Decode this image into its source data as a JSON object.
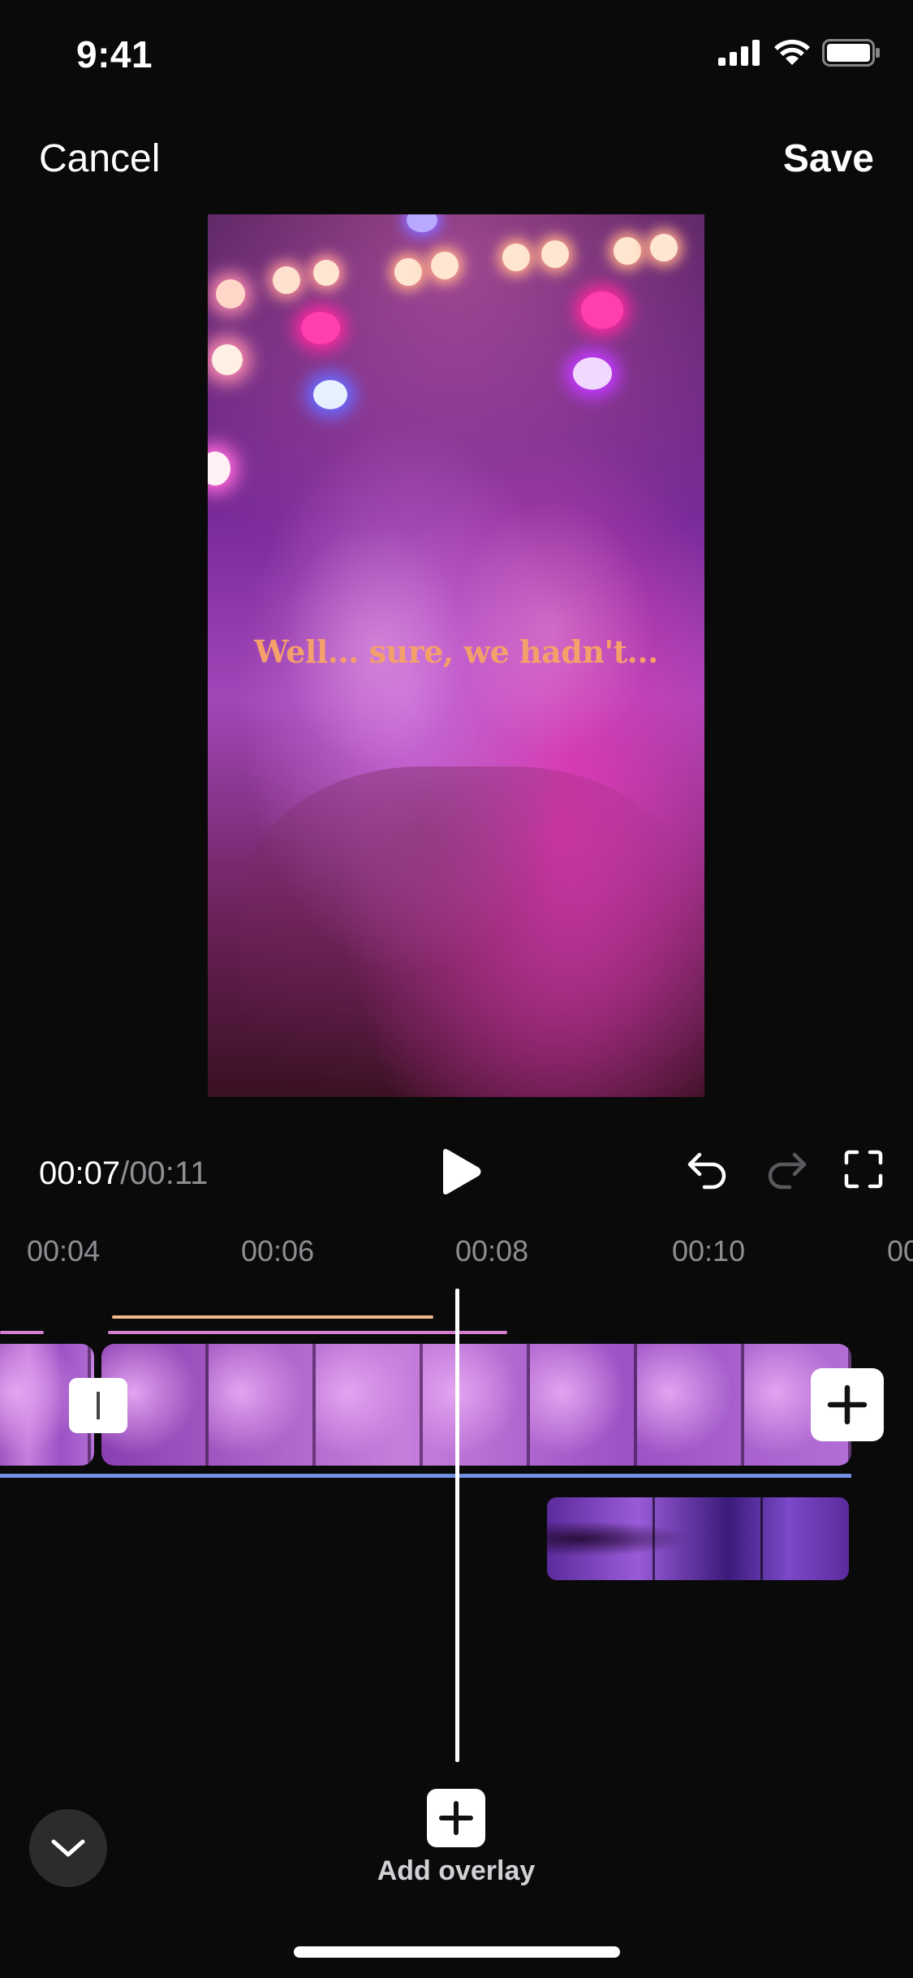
{
  "status_bar": {
    "time": "9:41",
    "icons": [
      "signal-icon",
      "wifi-icon",
      "battery-icon"
    ]
  },
  "nav": {
    "cancel_label": "Cancel",
    "save_label": "Save"
  },
  "preview": {
    "subtitle_text": "Well... sure, we hadn't...",
    "subtitle_color": "#f4a06a"
  },
  "playback": {
    "current_time": "00:07",
    "separator": "/",
    "total_time": "00:11",
    "icons": [
      "play-icon",
      "undo-icon",
      "redo-icon",
      "fullscreen-icon"
    ]
  },
  "timeline": {
    "ruler_ticks": [
      "00:04",
      "00:06",
      "00:08",
      "00:10",
      "00:"
    ],
    "track_colors": {
      "audio_line_peach": "#f1b98c",
      "audio_line_pink": "#d67fd1",
      "baseline_blue": "#6f90e0"
    }
  },
  "bottom": {
    "add_overlay_label": "Add overlay"
  }
}
